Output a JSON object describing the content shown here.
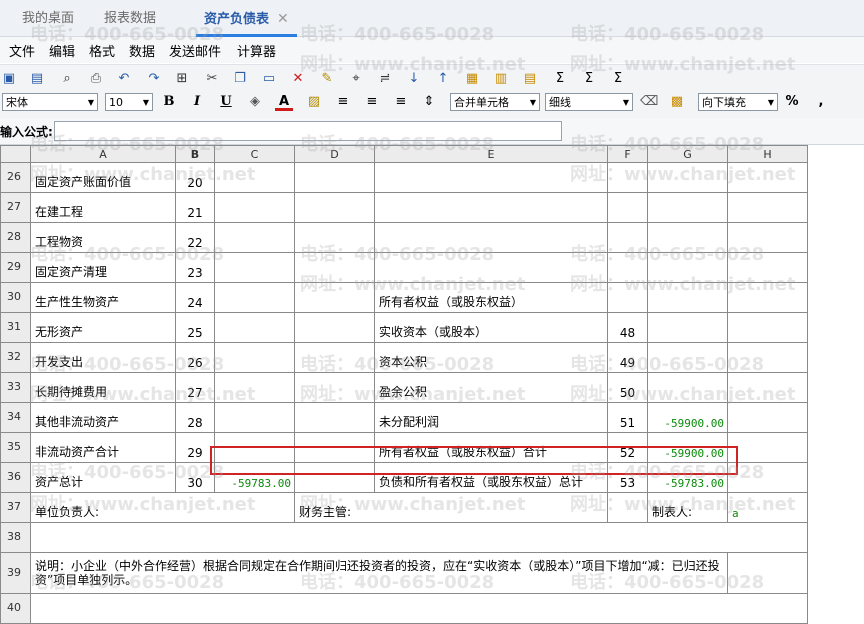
{
  "tabs": [
    {
      "label": "我的桌面"
    },
    {
      "label": "报表数据"
    },
    {
      "label": "资产负债表",
      "close": "✕"
    }
  ],
  "menu": [
    "文件",
    "编辑",
    "格式",
    "数据",
    "发送邮件",
    "计算器"
  ],
  "toolbar": {
    "font": "宋体",
    "size": "10",
    "bold": "B",
    "italic": "I",
    "underline": "U",
    "font_color_letter": "A",
    "merge": "合并单元格",
    "border": "细线",
    "fill": "向下填充",
    "percent": "%",
    "comma": ","
  },
  "formula_bar": {
    "label": "输入公式:",
    "value": ""
  },
  "columns": [
    "A",
    "B",
    "C",
    "D",
    "E",
    "F",
    "G",
    "H"
  ],
  "rows": [
    {
      "n": "26",
      "a": "固定资产账面价值",
      "b": "20",
      "c": "",
      "e": "",
      "f": "",
      "g": ""
    },
    {
      "n": "27",
      "a": "在建工程",
      "b": "21",
      "c": "",
      "e": "",
      "f": "",
      "g": ""
    },
    {
      "n": "28",
      "a": "工程物资",
      "b": "22",
      "c": "",
      "e": "",
      "f": "",
      "g": ""
    },
    {
      "n": "29",
      "a": "固定资产清理",
      "b": "23",
      "c": "",
      "e": "",
      "f": "",
      "g": ""
    },
    {
      "n": "30",
      "a": "生产性生物资产",
      "b": "24",
      "c": "",
      "e": "所有者权益（或股东权益）",
      "f": "",
      "g": ""
    },
    {
      "n": "31",
      "a": "无形资产",
      "b": "25",
      "c": "",
      "e": "实收资本（或股本）",
      "f": "48",
      "g": ""
    },
    {
      "n": "32",
      "a": "开发支出",
      "b": "26",
      "c": "",
      "e": "资本公积",
      "f": "49",
      "g": ""
    },
    {
      "n": "33",
      "a": "长期待摊费用",
      "b": "27",
      "c": "",
      "e": "盈余公积",
      "f": "50",
      "g": ""
    },
    {
      "n": "34",
      "a": "其他非流动资产",
      "b": "28",
      "c": "",
      "e": "未分配利润",
      "f": "51",
      "g": "-59900.00"
    },
    {
      "n": "35",
      "a": "非流动资产合计",
      "b": "29",
      "c": "",
      "e": "所有者权益（或股东权益）合计",
      "f": "52",
      "g": "-59900.00"
    },
    {
      "n": "36",
      "a": "资产总计",
      "b": "30",
      "c": "-59783.00",
      "e": "负债和所有者权益（或股东权益）总计",
      "f": "53",
      "g": "-59783.00"
    }
  ],
  "row37": {
    "n": "37",
    "a": "单位负责人:",
    "d": "财务主管:",
    "g": "制表人:",
    "h": "a"
  },
  "row38": {
    "n": "38"
  },
  "row39": {
    "n": "39",
    "text": "说明：小企业（中外合作经营）根据合同规定在合作期间归还投资者的投资，应在“实收资本（或股本）”项目下增加“减：已归还投资”项目单独列示。"
  },
  "row40": {
    "n": "40"
  },
  "watermark": {
    "phone": "电话：400-665-0028",
    "site": "网址：www.chanjet.net"
  }
}
